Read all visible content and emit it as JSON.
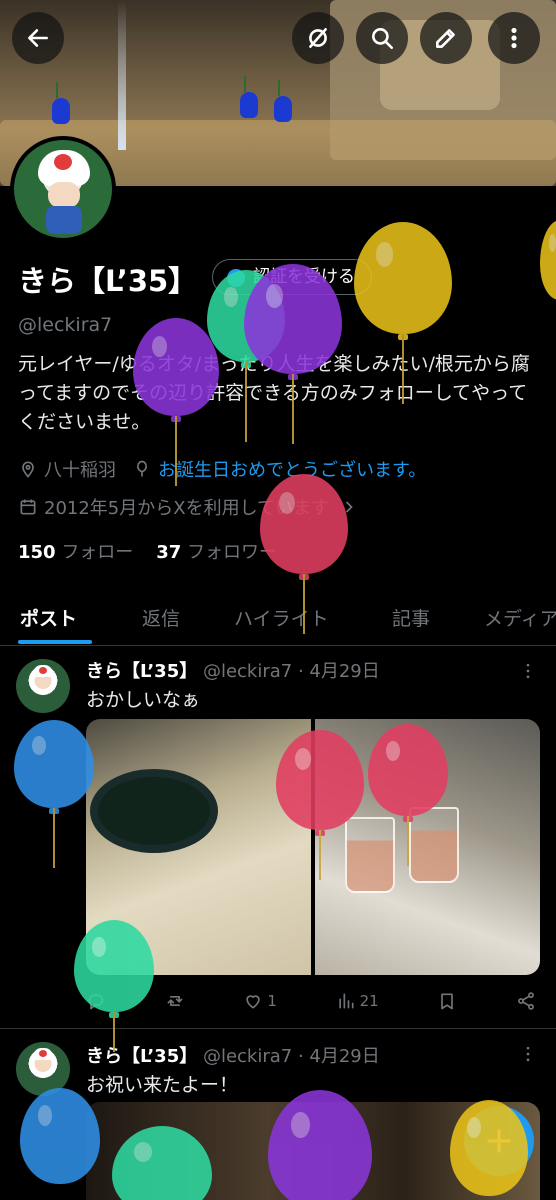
{
  "colors": {
    "background": "#000000",
    "accent": "#1d9bf0",
    "text_primary": "#e7e9ea",
    "text_secondary": "#71767b",
    "border": "#2f3336",
    "balloon_purple": "#8a35d9",
    "balloon_green": "#2ed9a0",
    "balloon_yellow": "#e8c11a",
    "balloon_red": "#e23e61",
    "balloon_blue": "#2f8fe6"
  },
  "header": {
    "back_icon": "arrow-left-icon",
    "grok_icon": "grok-slash-icon",
    "search_icon": "search-icon",
    "edit_icon": "pencil-icon",
    "more_icon": "kebab-icon"
  },
  "profile": {
    "display_name": "きら【L’35】",
    "verify_button": "認証を受ける",
    "handle": "@leckira7",
    "bio": "元レイヤー/ゆるオタ/まったり人生を楽しみたい/根元から腐ってますのでその辺り許容できる方のみフォローしてやってくださいませ。",
    "location": "八十稲羽",
    "birthday_text": "お誕生日おめでとうございます。",
    "joined": "2012年5月からXを利用しています",
    "following_count": "150",
    "following_label": "フォロー",
    "followers_count": "37",
    "followers_label": "フォロワー"
  },
  "tabs": [
    {
      "label": "ポスト",
      "active": true
    },
    {
      "label": "返信",
      "active": false
    },
    {
      "label": "ハイライト",
      "active": false
    },
    {
      "label": "記事",
      "active": false
    },
    {
      "label": "メディア",
      "active": false
    }
  ],
  "posts": [
    {
      "name": "きら【L’35】",
      "handle_date": "@leckira7 · 4月29日",
      "text": "おかしいなぁ",
      "likes": "1",
      "views": "21"
    },
    {
      "name": "きら【L’35】",
      "handle_date": "@leckira7 · 4月29日",
      "text": "お祝い来たよー！"
    }
  ],
  "fab": {
    "label": "+",
    "icon": "plus-icon"
  }
}
